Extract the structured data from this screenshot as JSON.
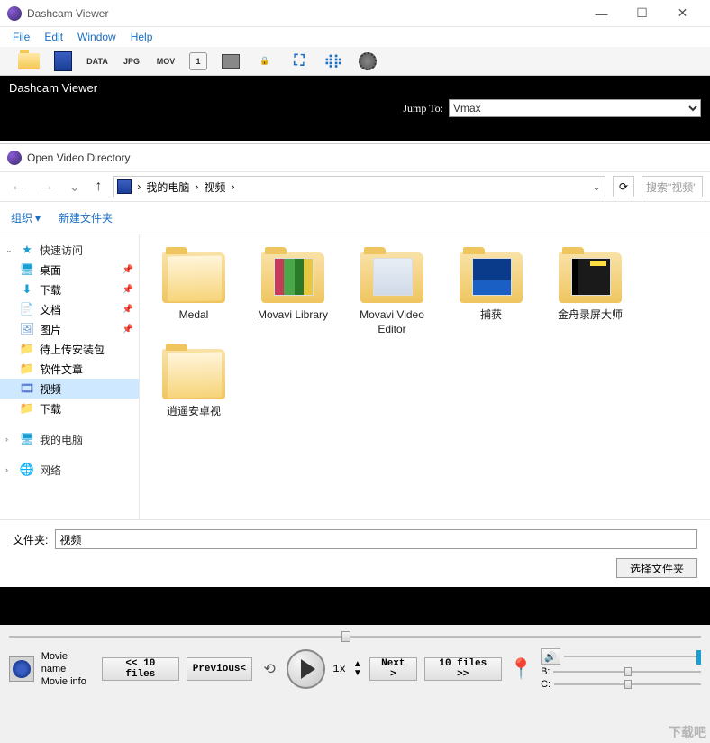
{
  "titlebar": {
    "title": "Dashcam Viewer"
  },
  "menubar": {
    "file": "File",
    "edit": "Edit",
    "window": "Window",
    "help": "Help"
  },
  "toolbar_labels": {
    "data": "DATA",
    "jpg": "JPG",
    "mov": "MOV",
    "one": "1"
  },
  "banner": {
    "app_name": "Dashcam Viewer",
    "jump_label": "Jump To:",
    "jump_value": "Vmax"
  },
  "dialog": {
    "title": "Open Video Directory",
    "breadcrumb": {
      "root": "我的电脑",
      "sub": "视频",
      "sep": "›"
    },
    "search_placeholder": "搜索\"视频\"",
    "organize": "组织",
    "new_folder": "新建文件夹",
    "sidebar": {
      "quick_access": "快速访问",
      "desktop": "桌面",
      "downloads": "下载",
      "documents": "文档",
      "pictures": "图片",
      "pending": "待上传安装包",
      "soft": "软件文章",
      "video": "视频",
      "dl2": "下载",
      "my_pc": "我的电脑",
      "network": "网络"
    },
    "files": [
      {
        "name": "Medal",
        "thumb": ""
      },
      {
        "name": "Movavi Library",
        "thumb": "movavi"
      },
      {
        "name": "Movavi Video Editor",
        "thumb": "editor"
      },
      {
        "name": "捕获",
        "thumb": "capture"
      },
      {
        "name": "金舟录屏大师",
        "thumb": "jinzhou"
      },
      {
        "name": "逍遥安卓视",
        "thumb": ""
      }
    ],
    "folder_label": "文件夹:",
    "folder_value": "视频",
    "select_btn": "选择文件夹"
  },
  "player": {
    "movie_name": "Movie name",
    "movie_info": "Movie info",
    "back_files": "<< 10 files",
    "prev": "Previous<",
    "next": "Next >",
    "fwd_files": "10 files >>",
    "speed": "1x",
    "b_label": "B:",
    "c_label": "C:"
  },
  "watermark": "下载吧"
}
